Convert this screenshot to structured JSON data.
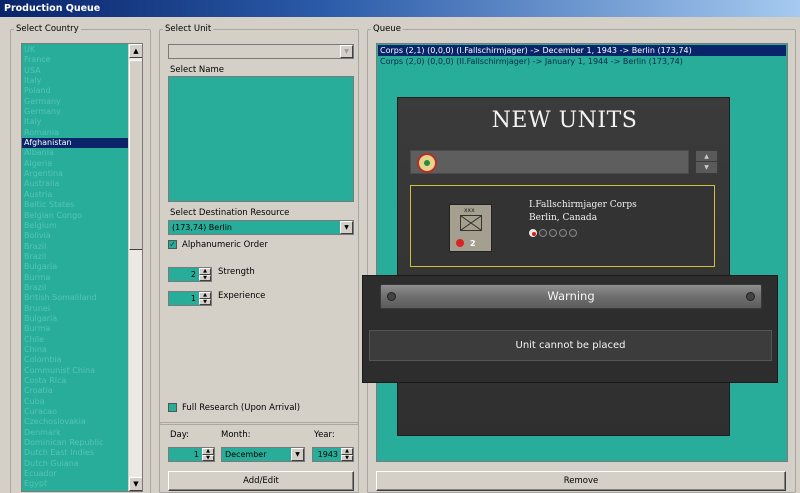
{
  "window": {
    "title": "Production Queue"
  },
  "country_panel": {
    "legend": "Select Country",
    "countries": [
      "UK",
      "France",
      "USA",
      "Italy",
      "Poland",
      "Germany",
      "Germany",
      "Italy",
      "Romania",
      "Afghanistan",
      "Albania",
      "Algeria",
      "Argentina",
      "Australia",
      "Austria",
      "Baltic States",
      "Belgian Congo",
      "Belgium",
      "Bolivia",
      "Brazil",
      "Brazil",
      "Bulgaria",
      "Burma",
      "Brazil",
      "British Somaliland",
      "Brunei",
      "Bulgaria",
      "Burma",
      "Chile",
      "China",
      "Colombia",
      "Communist China",
      "Costa Rica",
      "Croatia",
      "Cuba",
      "Curacao",
      "Czechoslovakia",
      "Denmark",
      "Dominican Republic",
      "Dutch East Indies",
      "Dutch Guiana",
      "Ecuador",
      "Egypt"
    ],
    "selected_index": 9
  },
  "unit_panel": {
    "legend": "Select Unit",
    "unit_value": "",
    "name_label": "Select Name",
    "dest_label": "Select Destination Resource",
    "dest_value": "(173,74) Berlin",
    "alpha_label": "Alphanumeric Order",
    "alpha_checked": true,
    "strength_value": "2",
    "strength_label": "Strength",
    "experience_value": "1",
    "experience_label": "Experience",
    "research_label": "Full Research (Upon Arrival)",
    "research_checked": false,
    "day_label": "Day:",
    "day_value": "1",
    "month_label": "Month:",
    "month_value": "December",
    "year_label": "Year:",
    "year_value": "1943",
    "add_edit_label": "Add/Edit"
  },
  "queue_panel": {
    "legend": "Queue",
    "items": [
      {
        "text": "Corps (2,1) (0,0,0) (I.Fallschirmjager) -> December 1, 1943 -> Berlin (173,74)",
        "selected": true
      },
      {
        "text": "Corps (2,0) (0,0,0) (II.Fallschirmjager) -> January 1, 1944 -> Berlin (173,74)",
        "selected": false
      }
    ],
    "remove_label": "Remove"
  },
  "game_overlay": {
    "title": "NEW UNITS",
    "unit_name": "I.Fallschirmjager Corps",
    "unit_location": "Berlin, Canada",
    "unit_strength": "2",
    "unit_size_marker": "xxx",
    "experience_level": 1,
    "experience_max": 5
  },
  "warning_dialog": {
    "title": "Warning",
    "message": "Unit cannot be placed"
  },
  "colors": {
    "list_teal": "#28ad9b",
    "selection": "#0a246a",
    "face": "#d4d0c8"
  }
}
